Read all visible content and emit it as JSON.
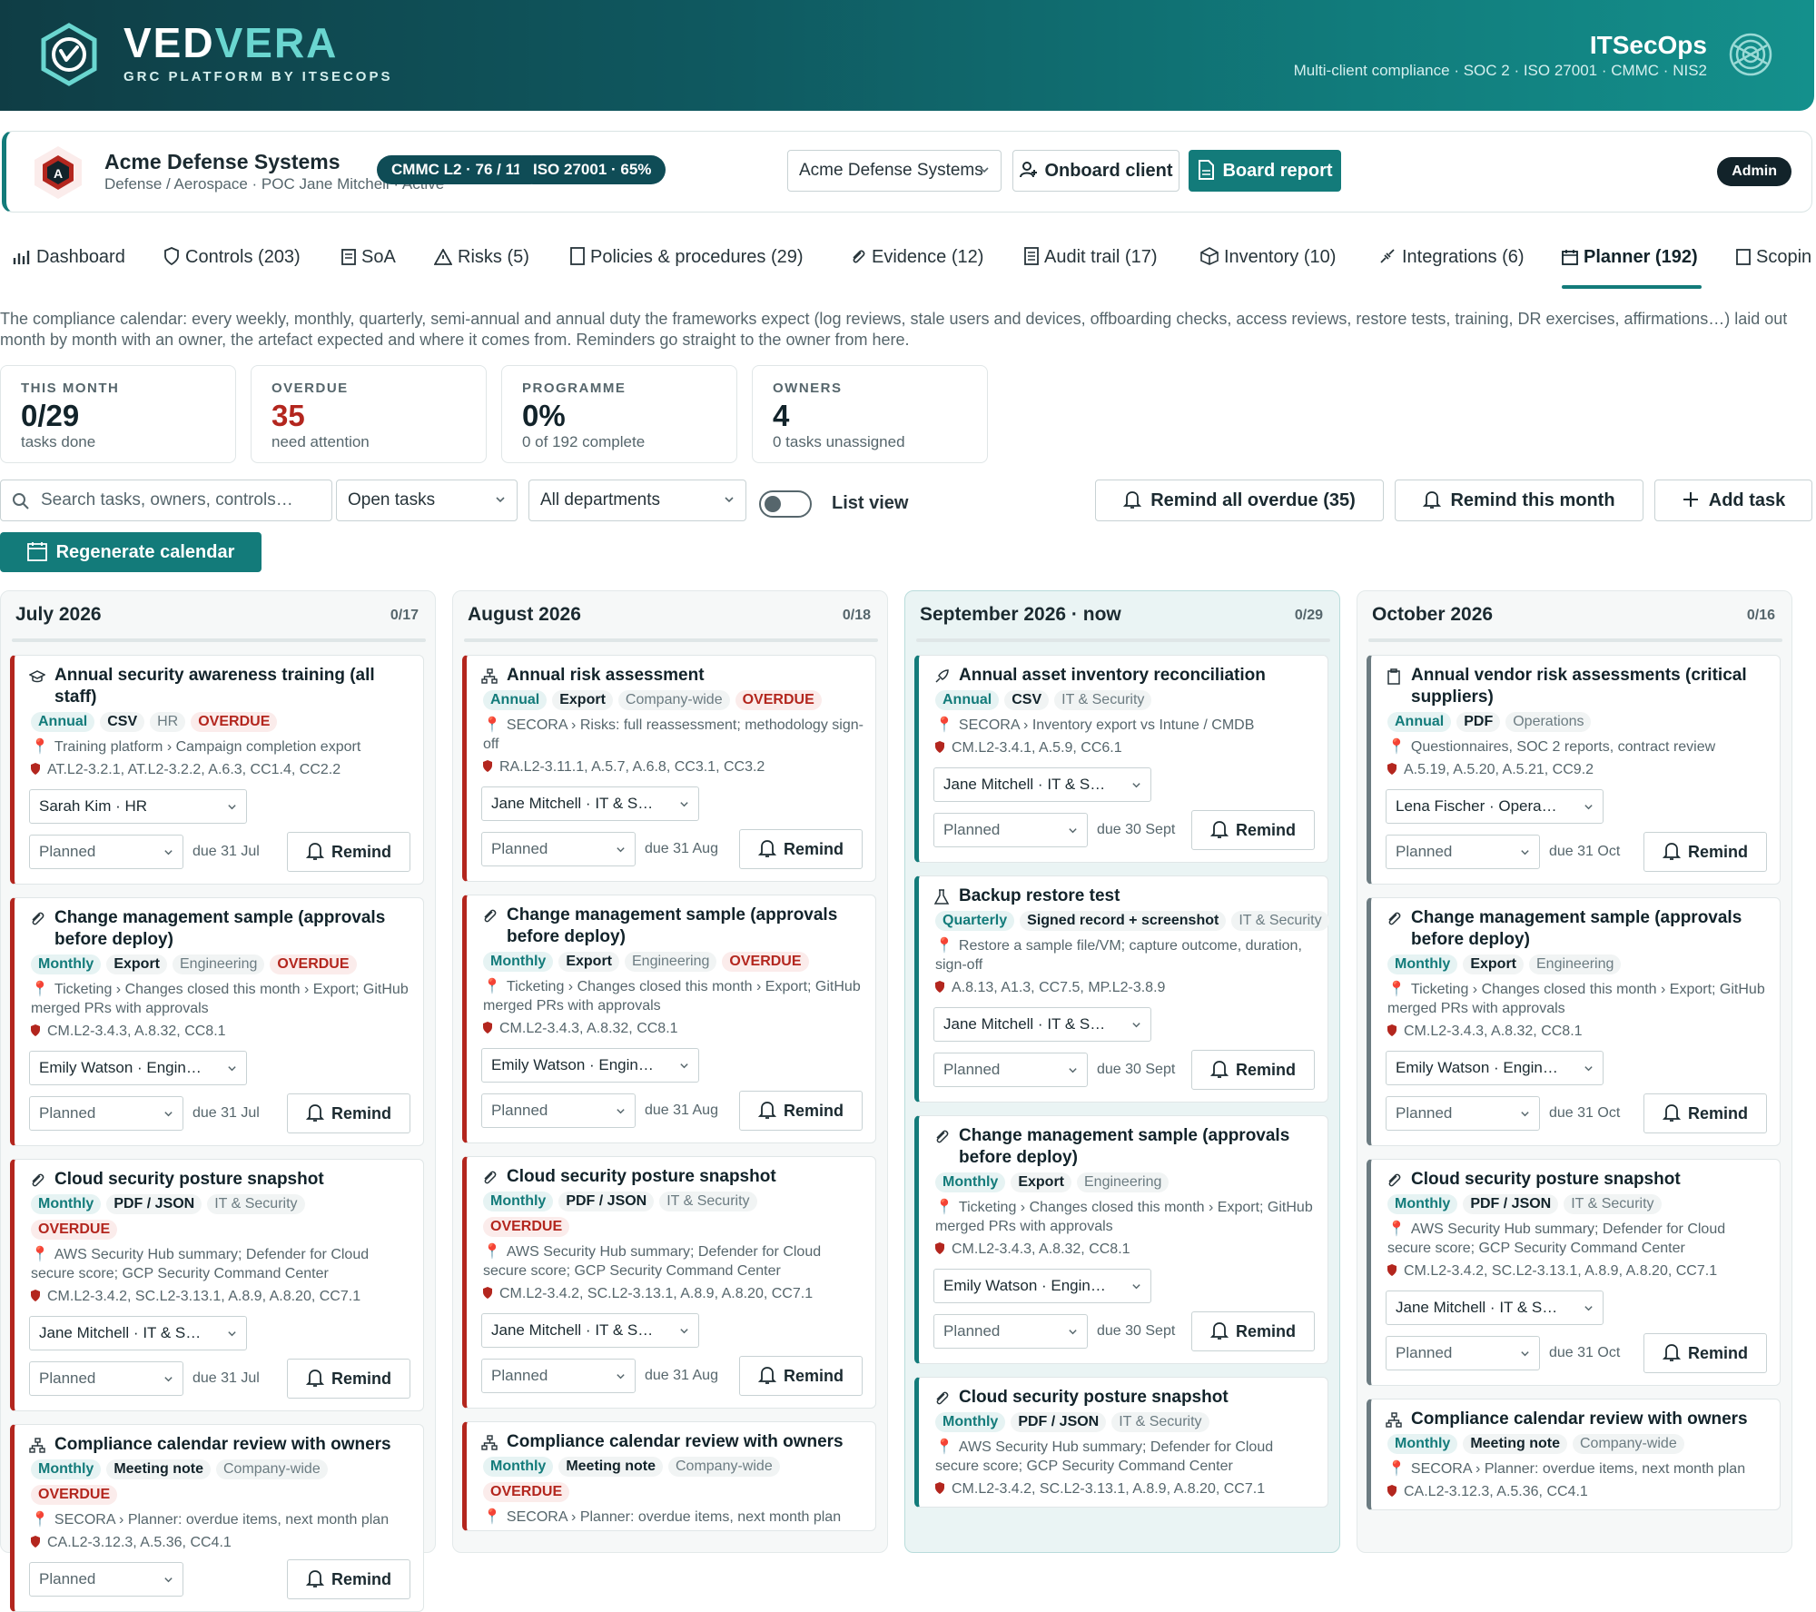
{
  "brand": {
    "name_a": "VED",
    "name_b": "VERA",
    "tagline": "GRC PLATFORM BY ITSECOPS"
  },
  "org": {
    "name": "ITSecOps",
    "subtitle": "Multi-client compliance · SOC 2 · ISO 27001 · CMMC · NIS2"
  },
  "client": {
    "name": "Acme Defense Systems",
    "meta": "Defense / Aerospace · POC Jane Mitchell · Active",
    "badge_cmmc": "CMMC L2 · 76 / 110",
    "badge_iso": "ISO 27001 · 65%",
    "selector": "Acme Defense Systems",
    "onboard": "Onboard client",
    "board": "Board report",
    "role": "Admin"
  },
  "tabs": [
    {
      "label": "Dashboard",
      "icon": "chart-icon"
    },
    {
      "label": "Controls (203)",
      "icon": "shield-icon"
    },
    {
      "label": "SoA",
      "icon": "clipboard-icon"
    },
    {
      "label": "Risks (5)",
      "icon": "warning-icon"
    },
    {
      "label": "Policies & procedures (29)",
      "icon": "document-icon"
    },
    {
      "label": "Evidence (12)",
      "icon": "paperclip-icon"
    },
    {
      "label": "Audit trail (17)",
      "icon": "list-icon"
    },
    {
      "label": "Inventory (10)",
      "icon": "box-icon"
    },
    {
      "label": "Integrations (6)",
      "icon": "plug-icon"
    },
    {
      "label": "Planner (192)",
      "icon": "calendar-icon"
    },
    {
      "label": "Scopin",
      "icon": "clipboard-icon"
    }
  ],
  "intro": "The compliance calendar: every weekly, monthly, quarterly, semi-annual and annual duty the frameworks expect (log reviews, stale users and devices, offboarding checks, access reviews, restore tests, training, DR exercises, affirmations…) laid out month by month with an owner, the artefact expected and where it comes from. Reminders go straight to the owner from here.",
  "stats": [
    {
      "label": "THIS MONTH",
      "value": "0/29",
      "sub": "tasks done"
    },
    {
      "label": "OVERDUE",
      "value": "35",
      "sub": "need attention"
    },
    {
      "label": "PROGRAMME",
      "value": "0%",
      "sub": "0 of 192 complete"
    },
    {
      "label": "OWNERS",
      "value": "4",
      "sub": "0 tasks unassigned"
    }
  ],
  "toolbar": {
    "search_placeholder": "Search tasks, owners, controls…",
    "status_filter": "Open tasks",
    "dept_filter": "All departments",
    "list_view": "List view",
    "remind_overdue": "Remind all overdue (35)",
    "remind_month": "Remind this month",
    "add_task": "Add task",
    "regenerate": "Regenerate calendar"
  },
  "columns": [
    {
      "title": "July 2026",
      "count": "0/17",
      "tasks": [
        {
          "title": "Annual security awareness training (all staff)",
          "icon": "graduation-cap-icon",
          "freq": "Annual",
          "artefact": "CSV",
          "dept": "HR",
          "overdue": "OVERDUE",
          "source": "Training platform › Campaign completion export",
          "controls": "AT.L2-3.2.1, AT.L2-3.2.2, A.6.3, CC1.4, CC2.2",
          "owner": "Sarah Kim · HR",
          "status": "Planned",
          "due": "due 31 Jul",
          "remind": "Remind"
        },
        {
          "title": "Change management sample (approvals before deploy)",
          "icon": "paperclip-icon",
          "freq": "Monthly",
          "artefact": "Export",
          "dept": "Engineering",
          "overdue": "OVERDUE",
          "source": "Ticketing › Changes closed this month › Export; GitHub merged PRs with approvals",
          "controls": "CM.L2-3.4.3, A.8.32, CC8.1",
          "owner": "Emily Watson · Engin…",
          "status": "Planned",
          "due": "due 31 Jul",
          "remind": "Remind"
        },
        {
          "title": "Cloud security posture snapshot",
          "icon": "paperclip-icon",
          "freq": "Monthly",
          "artefact": "PDF / JSON",
          "dept": "IT & Security",
          "overdue": "OVERDUE",
          "source": "AWS Security Hub summary; Defender for Cloud secure score; GCP Security Command Center",
          "controls": "CM.L2-3.4.2, SC.L2-3.13.1, A.8.9, A.8.20, CC7.1",
          "owner": "Jane Mitchell · IT & S…",
          "status": "Planned",
          "due": "due 31 Jul",
          "remind": "Remind"
        },
        {
          "title": "Compliance calendar review with owners",
          "icon": "org-chart-icon",
          "freq": "Monthly",
          "artefact": "Meeting note",
          "dept": "Company-wide",
          "overdue": "OVERDUE",
          "source": "SECORA › Planner: overdue items, next month plan",
          "controls": "CA.L2-3.12.3, A.5.36, CC4.1",
          "owner": "",
          "status": "Planned",
          "due": "",
          "remind": "Remind"
        }
      ]
    },
    {
      "title": "August 2026",
      "count": "0/18",
      "tasks": [
        {
          "title": "Annual risk assessment",
          "icon": "org-chart-icon",
          "freq": "Annual",
          "artefact": "Export",
          "dept": "Company-wide",
          "overdue": "OVERDUE",
          "source": "SECORA › Risks: full reassessment; methodology sign-off",
          "controls": "RA.L2-3.11.1, A.5.7, A.6.8, CC3.1, CC3.2",
          "owner": "Jane Mitchell · IT & S…",
          "status": "Planned",
          "due": "due 31 Aug",
          "remind": "Remind"
        },
        {
          "title": "Change management sample (approvals before deploy)",
          "icon": "paperclip-icon",
          "freq": "Monthly",
          "artefact": "Export",
          "dept": "Engineering",
          "overdue": "OVERDUE",
          "source": "Ticketing › Changes closed this month › Export; GitHub merged PRs with approvals",
          "controls": "CM.L2-3.4.3, A.8.32, CC8.1",
          "owner": "Emily Watson · Engin…",
          "status": "Planned",
          "due": "due 31 Aug",
          "remind": "Remind"
        },
        {
          "title": "Cloud security posture snapshot",
          "icon": "paperclip-icon",
          "freq": "Monthly",
          "artefact": "PDF / JSON",
          "dept": "IT & Security",
          "overdue": "OVERDUE",
          "source": "AWS Security Hub summary; Defender for Cloud secure score; GCP Security Command Center",
          "controls": "CM.L2-3.4.2, SC.L2-3.13.1, A.8.9, A.8.20, CC7.1",
          "owner": "Jane Mitchell · IT & S…",
          "status": "Planned",
          "due": "due 31 Aug",
          "remind": "Remind"
        },
        {
          "title": "Compliance calendar review with owners",
          "icon": "org-chart-icon",
          "freq": "Monthly",
          "artefact": "Meeting note",
          "dept": "Company-wide",
          "overdue": "OVERDUE",
          "source": "SECORA › Planner: overdue items, next month plan",
          "controls": "",
          "owner": "",
          "status": "",
          "due": "",
          "remind": ""
        }
      ]
    },
    {
      "title": "September 2026 · now",
      "count": "0/29",
      "tasks": [
        {
          "title": "Annual asset inventory reconciliation",
          "icon": "rocket-icon",
          "freq": "Annual",
          "artefact": "CSV",
          "dept": "IT & Security",
          "overdue": "",
          "source": "SECORA › Inventory export vs Intune / CMDB",
          "controls": "CM.L2-3.4.1, A.5.9, CC6.1",
          "owner": "Jane Mitchell · IT & S…",
          "status": "Planned",
          "due": "due 30 Sept",
          "remind": "Remind"
        },
        {
          "title": "Backup restore test",
          "icon": "flask-icon",
          "freq": "Quarterly",
          "artefact": "Signed record + screenshot",
          "dept": "IT & Security",
          "overdue": "",
          "source": "Restore a sample file/VM; capture outcome, duration, sign-off",
          "controls": "A.8.13, A1.3, CC7.5, MP.L2-3.8.9",
          "owner": "Jane Mitchell · IT & S…",
          "status": "Planned",
          "due": "due 30 Sept",
          "remind": "Remind"
        },
        {
          "title": "Change management sample (approvals before deploy)",
          "icon": "paperclip-icon",
          "freq": "Monthly",
          "artefact": "Export",
          "dept": "Engineering",
          "overdue": "",
          "source": "Ticketing › Changes closed this month › Export; GitHub merged PRs with approvals",
          "controls": "CM.L2-3.4.3, A.8.32, CC8.1",
          "owner": "Emily Watson · Engin…",
          "status": "Planned",
          "due": "due 30 Sept",
          "remind": "Remind"
        },
        {
          "title": "Cloud security posture snapshot",
          "icon": "paperclip-icon",
          "freq": "Monthly",
          "artefact": "PDF / JSON",
          "dept": "IT & Security",
          "overdue": "",
          "source": "AWS Security Hub summary; Defender for Cloud secure score; GCP Security Command Center",
          "controls": "CM.L2-3.4.2, SC.L2-3.13.1, A.8.9, A.8.20, CC7.1",
          "owner": "",
          "status": "",
          "due": "",
          "remind": ""
        }
      ]
    },
    {
      "title": "October 2026",
      "count": "0/16",
      "tasks": [
        {
          "title": "Annual vendor risk assessments (critical suppliers)",
          "icon": "clipboard-icon",
          "freq": "Annual",
          "artefact": "PDF",
          "dept": "Operations",
          "overdue": "",
          "source": "Questionnaires, SOC 2 reports, contract review",
          "controls": "A.5.19, A.5.20, A.5.21, CC9.2",
          "owner": "Lena Fischer · Opera…",
          "status": "Planned",
          "due": "due 31 Oct",
          "remind": "Remind"
        },
        {
          "title": "Change management sample (approvals before deploy)",
          "icon": "paperclip-icon",
          "freq": "Monthly",
          "artefact": "Export",
          "dept": "Engineering",
          "overdue": "",
          "source": "Ticketing › Changes closed this month › Export; GitHub merged PRs with approvals",
          "controls": "CM.L2-3.4.3, A.8.32, CC8.1",
          "owner": "Emily Watson · Engin…",
          "status": "Planned",
          "due": "due 31 Oct",
          "remind": "Remind"
        },
        {
          "title": "Cloud security posture snapshot",
          "icon": "paperclip-icon",
          "freq": "Monthly",
          "artefact": "PDF / JSON",
          "dept": "IT & Security",
          "overdue": "",
          "source": "AWS Security Hub summary; Defender for Cloud secure score; GCP Security Command Center",
          "controls": "CM.L2-3.4.2, SC.L2-3.13.1, A.8.9, A.8.20, CC7.1",
          "owner": "Jane Mitchell · IT & S…",
          "status": "Planned",
          "due": "due 31 Oct",
          "remind": "Remind"
        },
        {
          "title": "Compliance calendar review with owners",
          "icon": "org-chart-icon",
          "freq": "Monthly",
          "artefact": "Meeting note",
          "dept": "Company-wide",
          "overdue": "",
          "source": "SECORA › Planner: overdue items, next month plan",
          "controls": "CA.L2-3.12.3, A.5.36, CC4.1",
          "owner": "",
          "status": "",
          "due": "",
          "remind": ""
        }
      ]
    }
  ],
  "colors": {
    "accent": "#137b7a",
    "overdue": "#b3261e",
    "dark": "#0f4c56"
  }
}
